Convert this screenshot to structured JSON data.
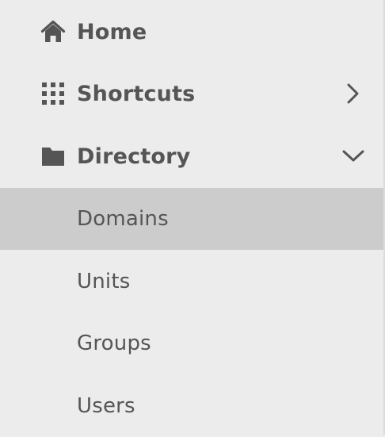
{
  "colors": {
    "background": "#ececec",
    "selected_background": "#cccccc",
    "text": "#555555"
  },
  "nav": {
    "home": {
      "label": "Home",
      "icon": "home-icon"
    },
    "shortcuts": {
      "label": "Shortcuts",
      "icon": "grid-icon",
      "chevron": "chevron-right-icon"
    },
    "directory": {
      "label": "Directory",
      "icon": "folder-icon",
      "chevron": "chevron-down-icon",
      "expanded": true,
      "children": [
        {
          "label": "Domains",
          "selected": true
        },
        {
          "label": "Units",
          "selected": false
        },
        {
          "label": "Groups",
          "selected": false
        },
        {
          "label": "Users",
          "selected": false
        }
      ]
    }
  }
}
